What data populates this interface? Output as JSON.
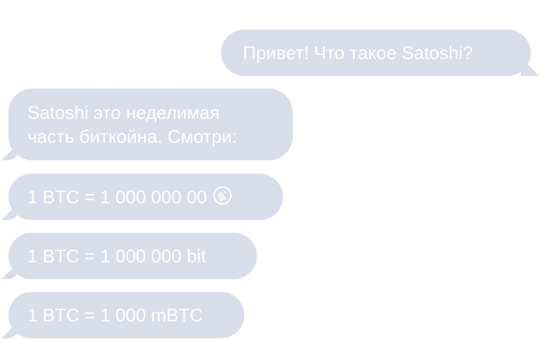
{
  "conversation": {
    "messages": [
      {
        "direction": "outgoing",
        "text": "Привет! Что такое Satoshi?"
      },
      {
        "direction": "incoming",
        "lines": [
          "Satoshi это неделимая",
          "часть биткойна. Смотри:"
        ]
      },
      {
        "direction": "incoming",
        "text": "1 BTC = 1 000 000 00",
        "icon": "satoshi-icon"
      },
      {
        "direction": "incoming",
        "text": "1 BTC = 1 000 000 bit"
      },
      {
        "direction": "incoming",
        "text": "1 BTC = 1 000 mBTC"
      }
    ]
  },
  "colors": {
    "bubble": "#d9dde9",
    "text": "#ffffff",
    "background": "#ffffff"
  }
}
